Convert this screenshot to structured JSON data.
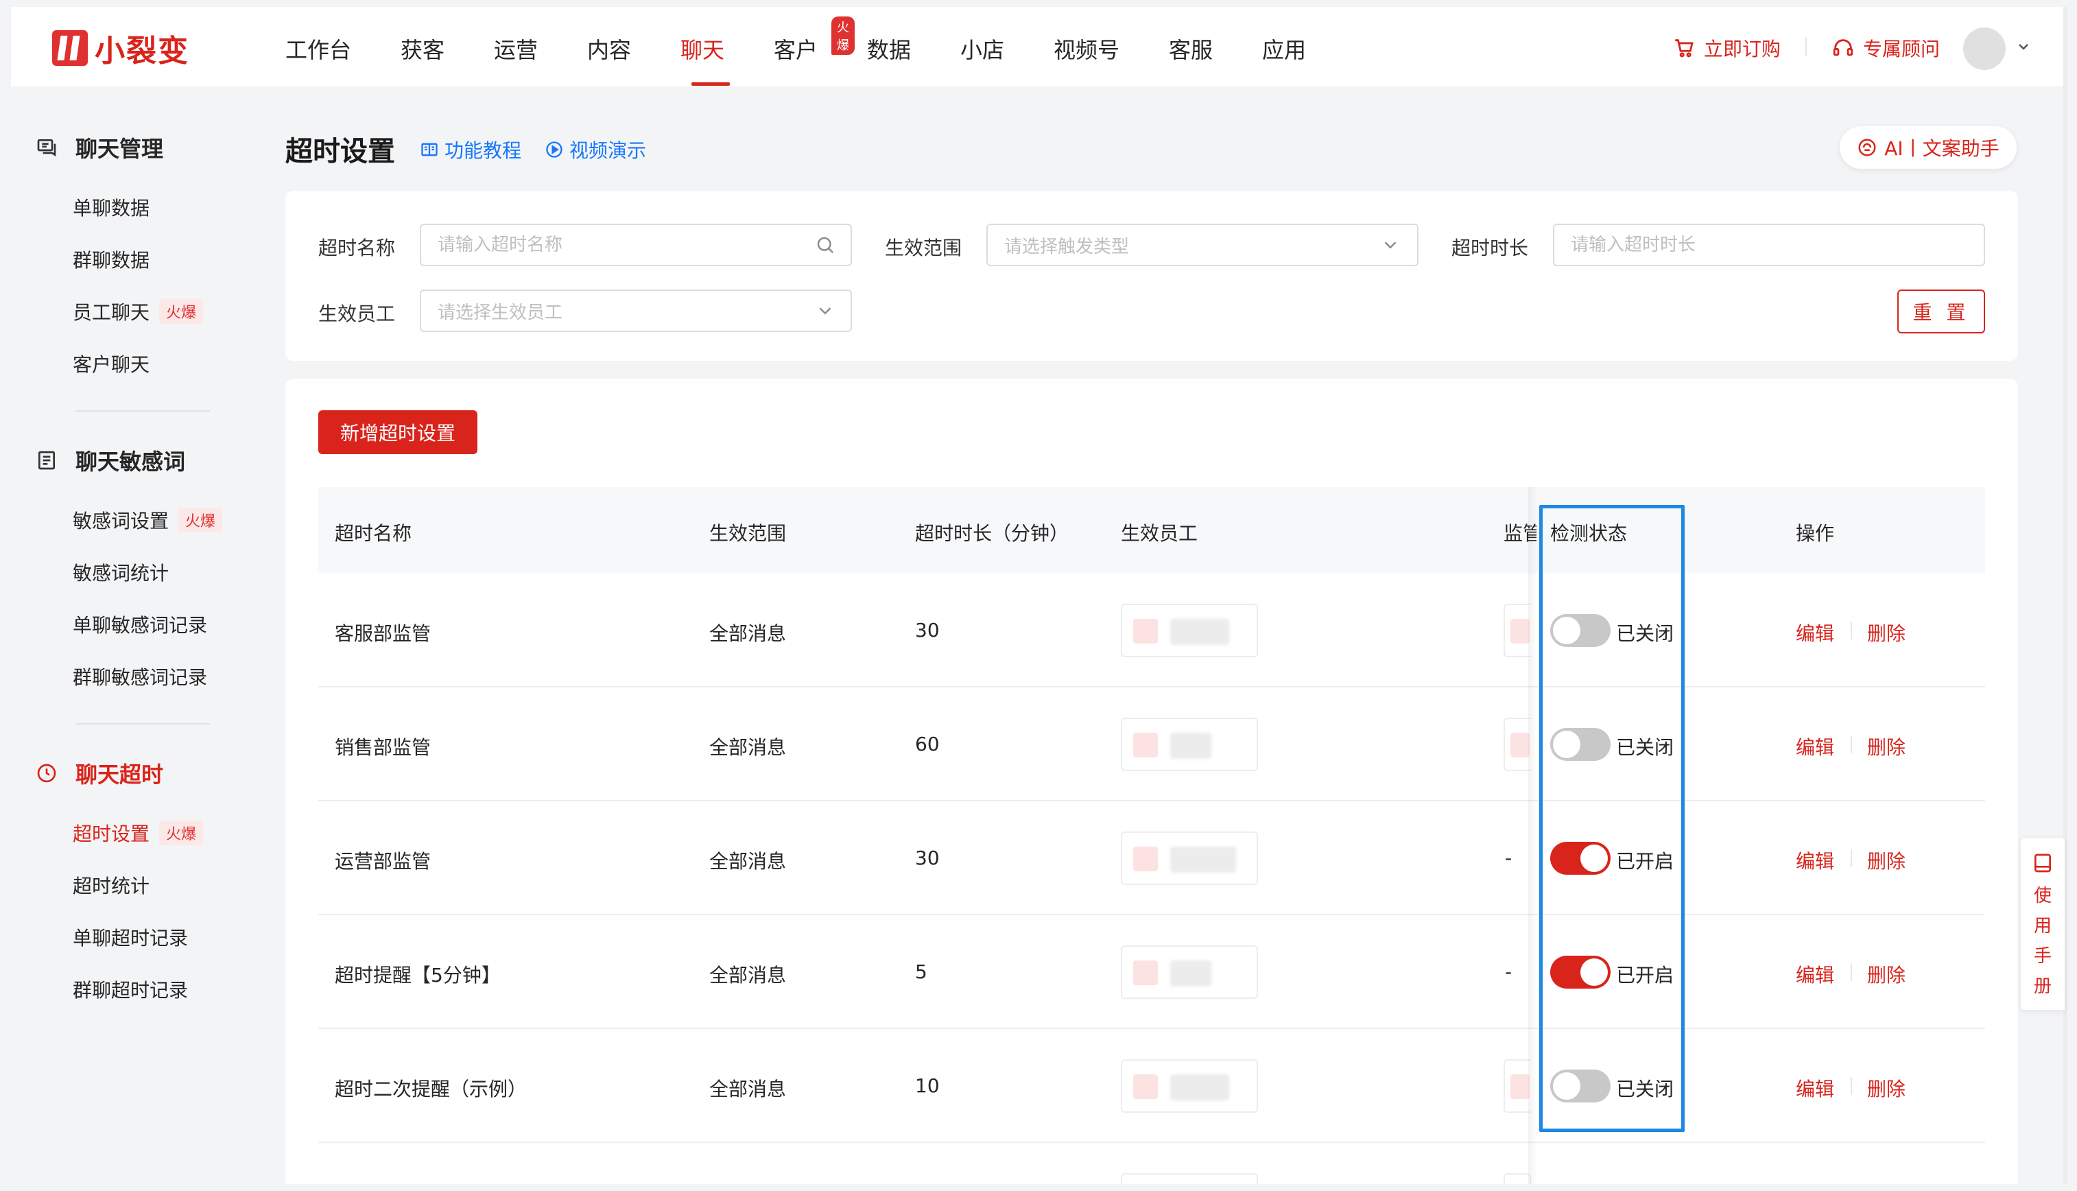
{
  "brand": {
    "name": "小裂变",
    "color": "#d9241c"
  },
  "nav": {
    "items": [
      "工作台",
      "获客",
      "运营",
      "内容",
      "聊天",
      "客户",
      "数据",
      "小店",
      "视频号",
      "客服",
      "应用"
    ],
    "active": "聊天",
    "badge": "火爆"
  },
  "top_right": {
    "order": "立即订购",
    "advisor": "专属顾问"
  },
  "sidebar": {
    "groups": [
      {
        "title": "聊天管理",
        "icon": "chat-icon",
        "items": [
          {
            "label": "单聊数据"
          },
          {
            "label": "群聊数据"
          },
          {
            "label": "员工聊天",
            "tag": "火爆"
          },
          {
            "label": "客户聊天"
          }
        ]
      },
      {
        "title": "聊天敏感词",
        "icon": "dictionary-icon",
        "items": [
          {
            "label": "敏感词设置",
            "tag": "火爆"
          },
          {
            "label": "敏感词统计"
          },
          {
            "label": "单聊敏感词记录"
          },
          {
            "label": "群聊敏感词记录"
          }
        ]
      },
      {
        "title": "聊天超时",
        "icon": "clock-icon",
        "active": true,
        "items": [
          {
            "label": "超时设置",
            "tag": "火爆",
            "active": true
          },
          {
            "label": "超时统计"
          },
          {
            "label": "单聊超时记录"
          },
          {
            "label": "群聊超时记录"
          }
        ]
      }
    ]
  },
  "page": {
    "title": "超时设置",
    "tutorial_link": "功能教程",
    "video_link": "视频演示",
    "ai_button": "AI丨文案助手"
  },
  "filters": {
    "name_label": "超时名称",
    "name_placeholder": "请输入超时名称",
    "scope_label": "生效范围",
    "scope_placeholder": "请选择触发类型",
    "duration_label": "超时时长",
    "duration_placeholder": "请输入超时时长",
    "employee_label": "生效员工",
    "employee_placeholder": "请选择生效员工",
    "reset": "重 置"
  },
  "table": {
    "add_button": "新增超时设置",
    "columns": [
      "超时名称",
      "生效范围",
      "超时时长（分钟）",
      "生效员工",
      "监管",
      "检测状态",
      "操作"
    ],
    "rows": [
      {
        "name": "客服部监管",
        "scope": "全部消息",
        "duration": "30",
        "supervisor": "",
        "enabled": false,
        "status": "已关闭"
      },
      {
        "name": "销售部监管",
        "scope": "全部消息",
        "duration": "60",
        "supervisor": "",
        "enabled": false,
        "status": "已关闭"
      },
      {
        "name": "运营部监管",
        "scope": "全部消息",
        "duration": "30",
        "supervisor": "-",
        "enabled": true,
        "status": "已开启"
      },
      {
        "name": "超时提醒【5分钟】",
        "scope": "全部消息",
        "duration": "5",
        "supervisor": "-",
        "enabled": true,
        "status": "已开启"
      },
      {
        "name": "超时二次提醒（示例）",
        "scope": "全部消息",
        "duration": "10",
        "supervisor": "",
        "enabled": false,
        "status": "已关闭"
      }
    ],
    "edit": "编辑",
    "delete": "删除"
  },
  "manual": {
    "chars": [
      "使",
      "用",
      "手",
      "册"
    ]
  },
  "colors": {
    "accent": "#d9241c",
    "link": "#1677ff",
    "highlight": "#1e88e5",
    "toggle_off": "#c8c8c8"
  }
}
